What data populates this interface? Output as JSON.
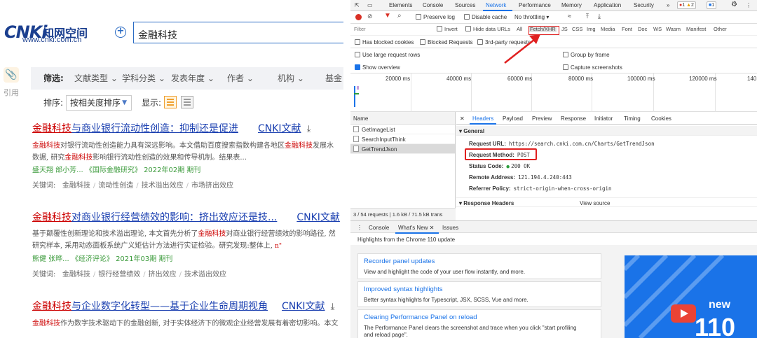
{
  "cnki": {
    "logo": {
      "mark": "CNKi",
      "name": "知网空间",
      "url": "www.cnki.com.cn"
    },
    "plus_icon": "+",
    "search_value": "金融科技",
    "cite_label": "引用",
    "filter": {
      "label": "筛选:",
      "options": [
        "文献类型",
        "学科分类",
        "发表年度",
        "作者",
        "机构",
        "基金"
      ]
    },
    "sort": {
      "label": "排序:",
      "value": "按相关度排序",
      "show_label": "显示:"
    },
    "results": [
      {
        "title_kw": "金融科技",
        "title_rest": "与商业银行流动性创造：抑制还是促进",
        "source": "CNKI文献",
        "abstract1_kw": "金融科技",
        "abstract1_rest": "对银行流动性创造能力具有深远影响。本文借助百度搜索指数构建各地区",
        "abstract1_kw2": "金融科技",
        "abstract1_rest2": "发展水",
        "abstract2_pre": "数据, 研究",
        "abstract2_kw": "金融科技",
        "abstract2_rest": "影响银行流动性创造的效果和传导机制。结果表...",
        "meta": "盛天翔  邰小芳...  《国际金融研究》  2022年02期  期刊",
        "keywords_label": "关键词:",
        "keywords": [
          "金融科技",
          "流动性创造",
          "技术溢出效应",
          "市场挤出效应"
        ]
      },
      {
        "title_kw": "金融科技",
        "title_rest": "对商业银行经营绩效的影响：挤出效应还是技...",
        "source": "CNKI文献",
        "abstract1_pre": "基于颠覆性创新理论和技术溢出理论, 本文首先分析了",
        "abstract1_kw": "金融科技",
        "abstract1_rest": "对商业银行经营绩效的影响路径, 然",
        "abstract2_pre": "研究样本, 采用动态面板系统广义矩估计方法进行实证检验。研究发现:整体上, ",
        "abstract2_kw": "",
        "abstract2_rest": "",
        "meta": "熊健  张晔...  《经济评论》  2021年03期  期刊",
        "keywords_label": "关键词:",
        "keywords": [
          "金融科技",
          "银行经营绩效",
          "挤出效应",
          "技术溢出效应"
        ]
      },
      {
        "title_kw": "金融科技",
        "title_rest": "与企业数字化转型——基于企业生命周期视角",
        "source": "CNKI文献",
        "abstract1_kw": "金融科技",
        "abstract1_rest": "作为数字技术驱动下的金融创新, 对于实体经济下的微观企业经营发展有着密切影响。本文"
      }
    ]
  },
  "devtools": {
    "tabs": [
      "Elements",
      "Console",
      "Sources",
      "Network",
      "Performance",
      "Memory",
      "Application",
      "Security"
    ],
    "more_tabs": "»",
    "errors": "1",
    "warnings": "2",
    "messages": "1",
    "toolbar": {
      "preserve_log": "Preserve log",
      "disable_cache": "Disable cache",
      "throttling": "No throttling"
    },
    "filter": {
      "placeholder": "Filter",
      "invert": "Invert",
      "hide_data_urls": "Hide data URLs",
      "types": [
        "All",
        "Fetch/XHR",
        "JS",
        "CSS",
        "Img",
        "Media",
        "Font",
        "Doc",
        "WS",
        "Wasm",
        "Manifest",
        "Other"
      ]
    },
    "blocked": {
      "has_blocked_cookies": "Has blocked cookies",
      "blocked_requests": "Blocked Requests",
      "third_party": "3rd-party requests"
    },
    "options": {
      "large_rows": "Use large request rows",
      "group_by_frame": "Group by frame",
      "show_overview": "Show overview",
      "capture_screenshots": "Capture screenshots"
    },
    "timeline_ticks": [
      "20000 ms",
      "40000 ms",
      "60000 ms",
      "80000 ms",
      "100000 ms",
      "120000 ms",
      "140"
    ],
    "request_list": {
      "name_header": "Name",
      "items": [
        "GetImageList",
        "SearchInputThink",
        "GetTrendJson"
      ],
      "status": "3 / 54 requests  |  1.6 kB / 71.5 kB trans"
    },
    "detail_tabs": [
      "Headers",
      "Payload",
      "Preview",
      "Response",
      "Initiator",
      "Timing",
      "Cookies"
    ],
    "general": {
      "title": "General",
      "request_url_label": "Request URL:",
      "request_url": "https://search.cnki.com.cn/Charts/GetTrendJson",
      "method_label": "Request Method:",
      "method": "POST",
      "status_label": "Status Code:",
      "status": "200  OK",
      "remote_label": "Remote Address:",
      "remote": "121.194.4.240:443",
      "referrer_label": "Referrer Policy:",
      "referrer": "strict-origin-when-cross-origin"
    },
    "response_headers": "Response Headers",
    "view_source": "View source",
    "drawer_tabs": [
      "Console",
      "What's New",
      "Issues"
    ],
    "highlights": "Highlights from the Chrome 110 update",
    "cards": [
      {
        "title": "Recorder panel updates",
        "desc": "View and highlight the code of your user flow instantly, and more."
      },
      {
        "title": "Improved syntax highlights",
        "desc": "Better syntax highlights for Typescript, JSX, SCSS, Vue and more."
      },
      {
        "title": "Clearing Performance Panel on reload",
        "desc": "The Performance Panel clears the screenshot and trace when you click \"start profiling",
        "desc2": "and reload page\"."
      }
    ],
    "promo": {
      "new": "new",
      "version": "110"
    },
    "colors": {
      "accent": "#1a73e8",
      "highlight": "#e02020",
      "ok": "#2e9e3e"
    }
  }
}
